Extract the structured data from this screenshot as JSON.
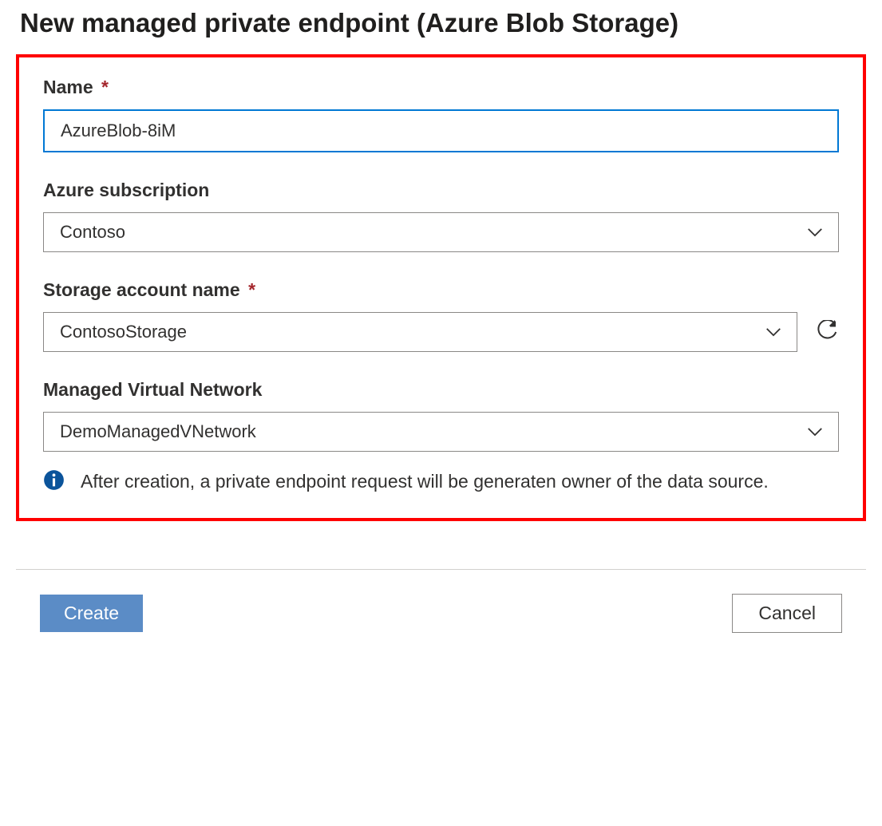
{
  "title": "New managed private endpoint (Azure Blob Storage)",
  "form": {
    "name": {
      "label": "Name",
      "value": "AzureBlob-8iM",
      "required_marker": "*"
    },
    "subscription": {
      "label": "Azure subscription",
      "value": "Contoso"
    },
    "storage_account": {
      "label": "Storage account name",
      "value": "ContosoStorage",
      "required_marker": "*"
    },
    "managed_vnet": {
      "label": "Managed Virtual Network",
      "value": "DemoManagedVNetwork"
    },
    "info_message": "After creation, a private endpoint request will be generaten owner of the data source."
  },
  "buttons": {
    "create": "Create",
    "cancel": "Cancel"
  }
}
